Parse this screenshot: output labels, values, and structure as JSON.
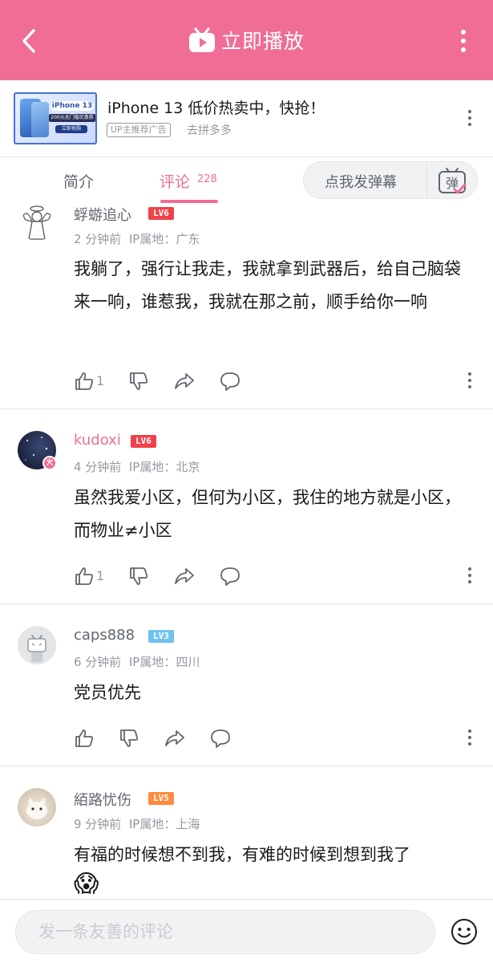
{
  "header": {
    "title": "立即播放",
    "back_icon": "chevron-left-icon",
    "more_icon": "more-vertical-icon",
    "bg_color": "#f06e96"
  },
  "ad": {
    "thumb_line1": "iPhone 13",
    "thumb_line2": "200元无门槛优惠券",
    "thumb_line3": "立即抢购",
    "title": "iPhone 13 低价热卖中，快抢！",
    "tag": "UP主推荐广告",
    "link": "去拼多多"
  },
  "tabs": {
    "intro": "简介",
    "comments": "评论",
    "comment_count": "228",
    "danmu_placeholder": "点我发弹幕",
    "danmu_icon_text": "弹"
  },
  "comments": [
    {
      "username": "蜉蝣追心",
      "level": "LV6",
      "time": "2 分钟前",
      "ip": "IP属地：广东",
      "text": "我躺了，强行让我走，我就拿到武器后，给自己脑袋来一响，谁惹我，我就在那之前，顺手给你一响",
      "likes": "1"
    },
    {
      "username": "kudoxi",
      "level": "LV6",
      "time": "4 分钟前",
      "ip": "IP属地：北京",
      "text": "虽然我爱小区，但何为小区，我住的地方就是小区，而物业≠小区",
      "likes": "1"
    },
    {
      "username": "caps888",
      "level": "LV3",
      "time": "6 分钟前",
      "ip": "IP属地：四川",
      "text": "党员优先",
      "likes": ""
    },
    {
      "username": "絔路忧伤",
      "level": "LV5",
      "time": "9 分钟前",
      "ip": "IP属地：上海",
      "text": "有福的时候想不到我，有难的时候到想到我了",
      "emoji": "😱"
    }
  ],
  "composer": {
    "placeholder": "发一条友善的评论",
    "emoji_icon": "smiley-icon"
  },
  "colors": {
    "accent": "#f06e96",
    "lv6": "#f0414a",
    "lv5": "#ff8a3d",
    "lv3": "#6fc2f0",
    "vip_name": "#f06e96"
  }
}
